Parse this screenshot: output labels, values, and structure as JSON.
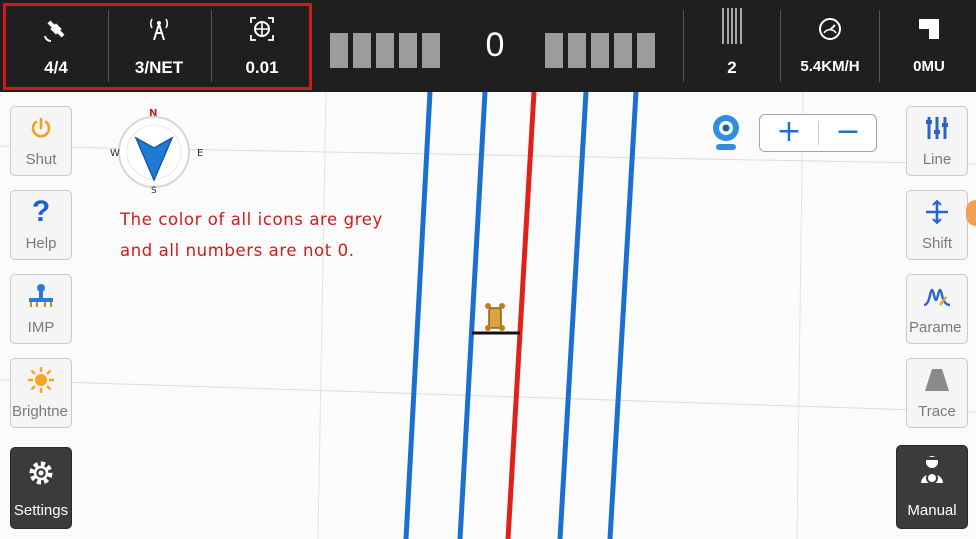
{
  "status_bar": {
    "satellites": "4/4",
    "rtk": "3/NET",
    "precision": "0.01",
    "offset": "0",
    "line_number": "2",
    "speed": "5.4KM/H",
    "area": "0MU"
  },
  "left_buttons": [
    {
      "label": "Shut",
      "icon": "power-icon"
    },
    {
      "label": "Help",
      "icon": "question-icon"
    },
    {
      "label": "IMP",
      "icon": "implement-icon"
    },
    {
      "label": "Brightne",
      "icon": "sun-icon"
    },
    {
      "label": "Settings",
      "icon": "gear-icon"
    }
  ],
  "right_buttons": [
    {
      "label": "Line",
      "icon": "sliders-icon"
    },
    {
      "label": "Shift",
      "icon": "shift-arrows-icon"
    },
    {
      "label": "Parame",
      "icon": "wave-icon"
    },
    {
      "label": "Trace",
      "icon": "trace-icon"
    },
    {
      "label": "Manual",
      "icon": "driver-icon"
    }
  ],
  "compass": {
    "n": "N",
    "e": "E",
    "s": "S",
    "w": "W"
  },
  "zoom": {
    "in": "+",
    "out": "−"
  },
  "note": "The color of all icons are grey and all numbers are not 0.",
  "colors": {
    "guide_line": "#1a6fd0",
    "active_line": "#e0201a",
    "highlight": "#d01a1a",
    "topbar": "#1f1f1f"
  }
}
